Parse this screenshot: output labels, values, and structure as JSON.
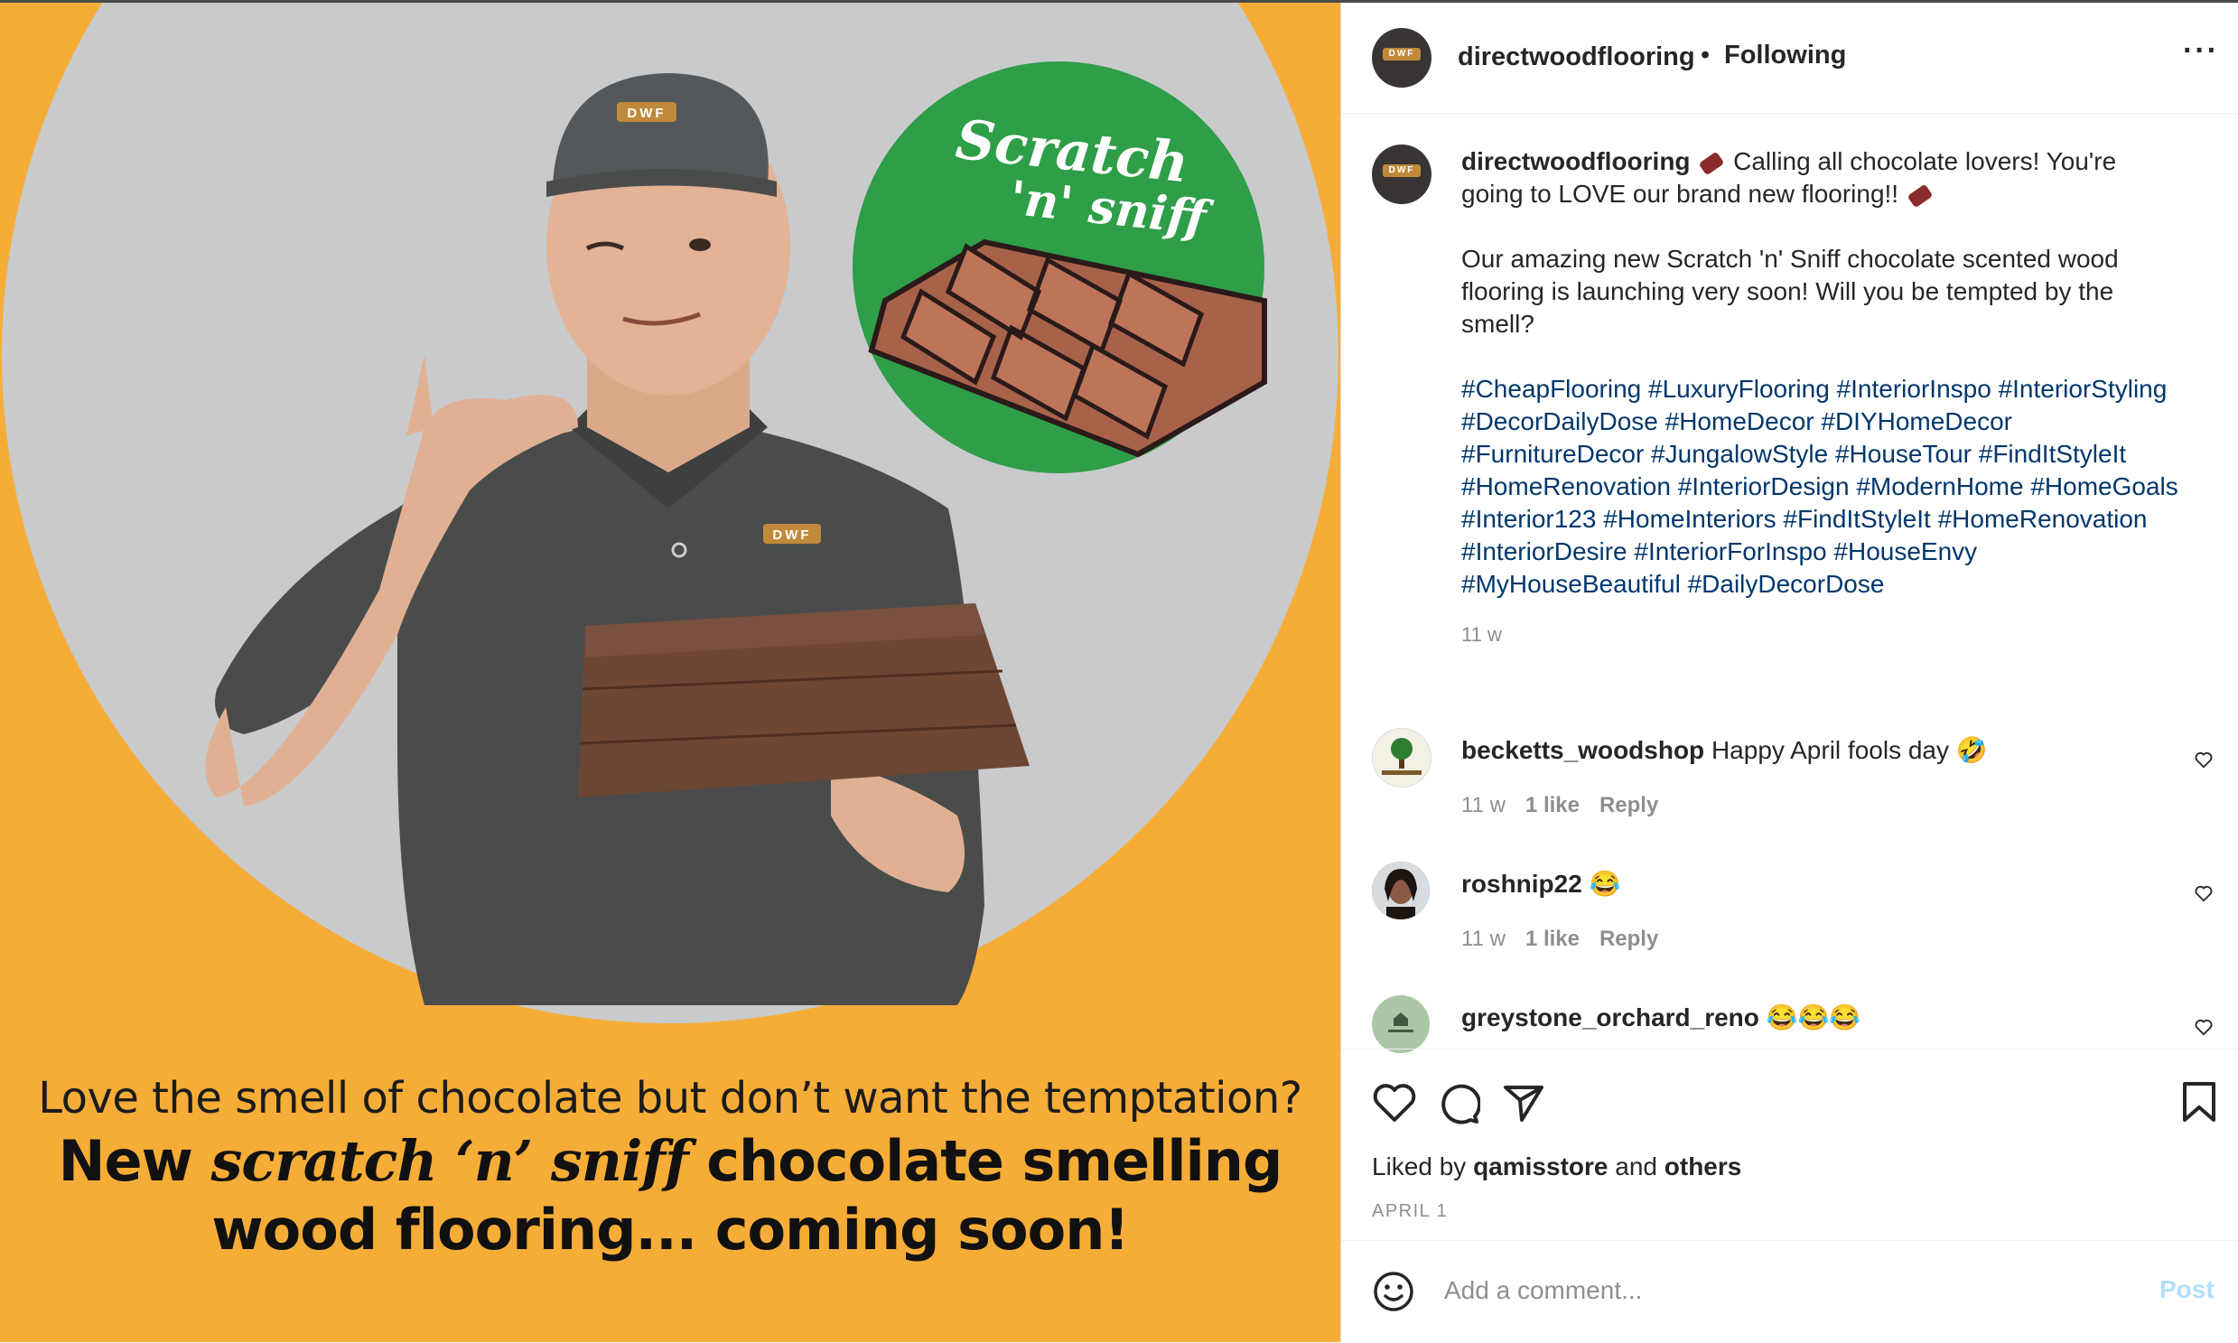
{
  "colors": {
    "media_orange": "#f5ad38",
    "media_grey": "#c9cacc",
    "badge_green": "#2e9e48",
    "chocolate": "#a8624a",
    "link_blue": "#00376b",
    "post_button": "#b2dffc"
  },
  "media": {
    "badge_text_line1": "Scratch",
    "badge_text_line2": "'n' sniff",
    "cap_logo": "DWF",
    "shirt_logo": "DWF",
    "caption_line1": "Love the smell of chocolate but don’t want the temptation?",
    "caption_line2_a": "New ",
    "caption_line2_script": "scratch ‘n’ sniff",
    "caption_line2_b": " chocolate smelling",
    "caption_line3": "wood flooring... coming soon!"
  },
  "header": {
    "avatar_logo": "DWF",
    "username": "directwoodflooring",
    "separator": "•",
    "follow_status": "Following",
    "more_icon": "more-horizontal-icon"
  },
  "post": {
    "avatar_logo": "DWF",
    "username": "directwoodflooring",
    "line1": " Calling all chocolate lovers! You're going to LOVE our brand new flooring!! ",
    "line2": "Our amazing new Scratch 'n' Sniff chocolate scented wood flooring is launching very soon! Will you be tempted by the smell?",
    "hashtags": "#CheapFlooring #LuxuryFlooring #InteriorInspo #InteriorStyling #DecorDailyDose #HomeDecor #DIYHomeDecor #FurnitureDecor #JungalowStyle #HouseTour #FindItStyleIt #HomeRenovation #InteriorDesign #ModernHome #HomeGoals #Interior123 #HomeInteriors #FindItStyleIt #HomeRenovation #InteriorDesire #InteriorForInspo #HouseEnvy #MyHouseBeautiful #DailyDecorDose",
    "age": "11 w"
  },
  "comments": [
    {
      "username": "becketts_woodshop",
      "text": "Happy April fools day 🤣",
      "age": "11 w",
      "likes": "1 like",
      "reply": "Reply"
    },
    {
      "username": "roshnip22",
      "text": "😂",
      "age": "11 w",
      "likes": "1 like",
      "reply": "Reply"
    },
    {
      "username": "greystone_orchard_reno",
      "text": "😂😂😂"
    }
  ],
  "actions": {
    "liked_prefix": "Liked by ",
    "liked_user": "qamisstore",
    "liked_mid": " and ",
    "liked_others": "others",
    "date": "APRIL 1"
  },
  "add_comment": {
    "placeholder": "Add a comment...",
    "post_label": "Post"
  }
}
